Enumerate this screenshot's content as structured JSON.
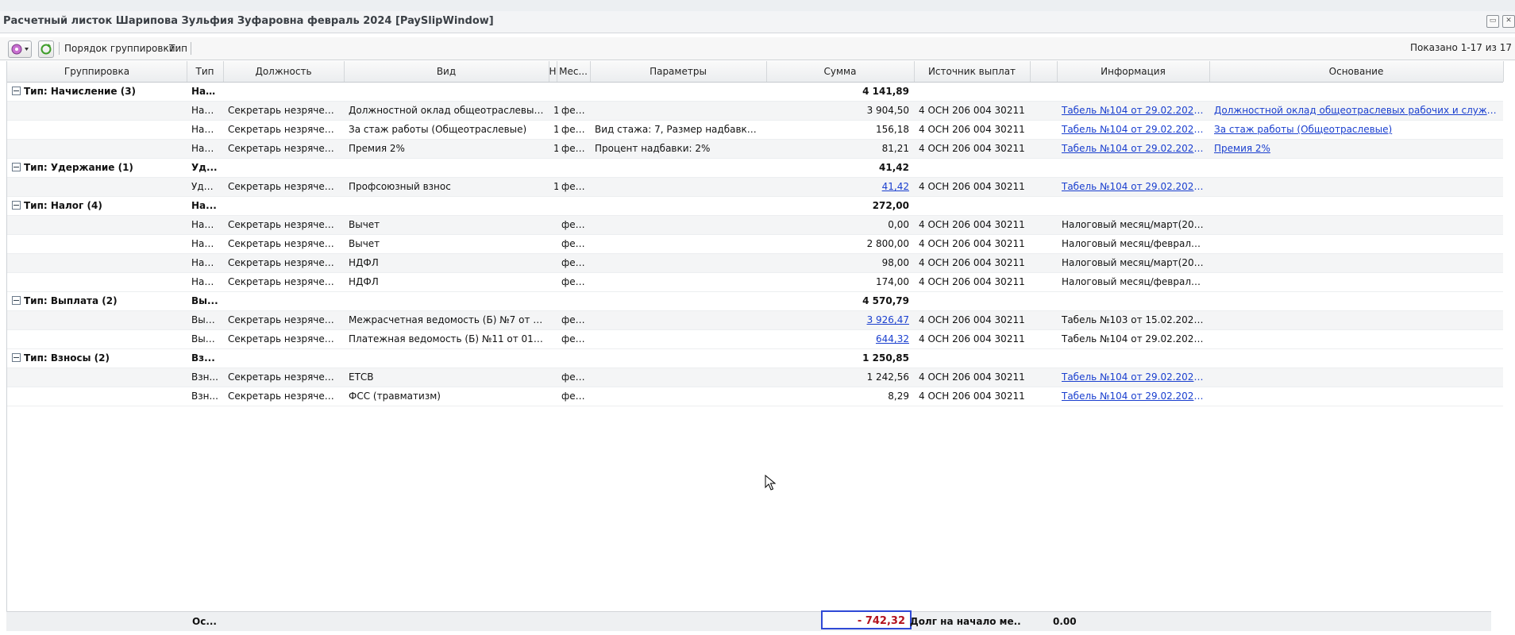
{
  "window": {
    "title": "Расчетный листок Шарипова Зульфия Зуфаровна февраль 2024 [PaySlipWindow]"
  },
  "toolbar": {
    "grouping_label": "Порядок группировки:",
    "grouping_value": "Тип",
    "shown": "Показано 1-17 из 17"
  },
  "columns": [
    "Группировка",
    "Тип",
    "Должность",
    "Вид",
    "Н",
    "Мес...",
    "Параметры",
    "Сумма",
    "Источник выплат",
    "",
    "Информация",
    "Основание"
  ],
  "groups": [
    {
      "label": "Тип: Начисление (3)",
      "type": "Нач...",
      "sum": "4 141,89",
      "rows": [
        {
          "type": "Нач...",
          "pos": "Секретарь незрячего ...",
          "kind": "Должностной оклад общеотраслевых ра...",
          "n": "1",
          "month": "фев...",
          "params": "",
          "sum": "3 904,50",
          "sum_link": false,
          "source": "4 ОСН 206 004 30211",
          "info": "Табель №104 от 29.02.2024 (...",
          "info_link": true,
          "basis": "Должностной оклад общеотраслевых рабочих и служащих",
          "basis_link": true
        },
        {
          "type": "Нач...",
          "pos": "Секретарь незрячего ...",
          "kind": "За стаж работы (Общеотраслевые)",
          "n": "1",
          "month": "фев...",
          "params": "Вид стажа: 7, Размер надбавки (%...",
          "sum": "156,18",
          "sum_link": false,
          "source": "4 ОСН 206 004 30211",
          "info": "Табель №104 от 29.02.2024 (...",
          "info_link": true,
          "basis": "За стаж работы (Общеотраслевые)",
          "basis_link": true
        },
        {
          "type": "Нач...",
          "pos": "Секретарь незрячего ...",
          "kind": "Премия 2%",
          "n": "1",
          "month": "фев...",
          "params": "Процент надбавки: 2%",
          "sum": "81,21",
          "sum_link": false,
          "source": "4 ОСН 206 004 30211",
          "info": "Табель №104 от 29.02.2024 (...",
          "info_link": true,
          "basis": "Премия 2%",
          "basis_link": true
        }
      ]
    },
    {
      "label": "Тип: Удержание (1)",
      "type": "Уд...",
      "sum": "41,42",
      "rows": [
        {
          "type": "Уде...",
          "pos": "Секретарь незрячего ...",
          "kind": "Профсоюзный взнос",
          "n": "1",
          "month": "фев...",
          "params": "",
          "sum": "41,42",
          "sum_link": true,
          "source": "4 ОСН 206 004 30211",
          "info": "Табель №104 от 29.02.2024 (...",
          "info_link": true,
          "basis": "",
          "basis_link": false
        }
      ]
    },
    {
      "label": "Тип: Налог (4)",
      "type": "На...",
      "sum": "272,00",
      "rows": [
        {
          "type": "Налог",
          "pos": "Секретарь незрячего ...",
          "kind": "Вычет",
          "n": "",
          "month": "фев...",
          "params": "",
          "sum": "0,00",
          "sum_link": false,
          "source": "4 ОСН 206 004 30211",
          "info": "Налоговый месяц/март(2024)",
          "info_link": false,
          "basis": "",
          "basis_link": false
        },
        {
          "type": "Налог",
          "pos": "Секретарь незрячего ...",
          "kind": "Вычет",
          "n": "",
          "month": "фев...",
          "params": "",
          "sum": "2 800,00",
          "sum_link": false,
          "source": "4 ОСН 206 004 30211",
          "info": "Налоговый месяц/февраль(2...",
          "info_link": false,
          "basis": "",
          "basis_link": false
        },
        {
          "type": "Налог",
          "pos": "Секретарь незрячего ...",
          "kind": "НДФЛ",
          "n": "",
          "month": "фев...",
          "params": "",
          "sum": "98,00",
          "sum_link": false,
          "source": "4 ОСН 206 004 30211",
          "info": "Налоговый месяц/март(2024)",
          "info_link": false,
          "basis": "",
          "basis_link": false
        },
        {
          "type": "Налог",
          "pos": "Секретарь незрячего ...",
          "kind": "НДФЛ",
          "n": "",
          "month": "фев...",
          "params": "",
          "sum": "174,00",
          "sum_link": false,
          "source": "4 ОСН 206 004 30211",
          "info": "Налоговый месяц/февраль(2...",
          "info_link": false,
          "basis": "",
          "basis_link": false
        }
      ]
    },
    {
      "label": "Тип: Выплата (2)",
      "type": "Вы...",
      "sum": "4 570,79",
      "rows": [
        {
          "type": "Вып...",
          "pos": "Секретарь незрячего ...",
          "kind": "Межрасчетная ведомость (Б) №7 от 15....",
          "n": "",
          "month": "фев...",
          "params": "",
          "sum": "3 926,47",
          "sum_link": true,
          "source": "4 ОСН 206 004 30211",
          "info": "Табель №103 от 15.02.2024 (...",
          "info_link": false,
          "basis": "",
          "basis_link": false
        },
        {
          "type": "Вып...",
          "pos": "Секретарь незрячего ...",
          "kind": "Платежная ведомость (Б) №11 от 01.03....",
          "n": "",
          "month": "фев...",
          "params": "",
          "sum": "644,32",
          "sum_link": true,
          "source": "4 ОСН 206 004 30211",
          "info": "Табель №104 от 29.02.2024 (...",
          "info_link": false,
          "basis": "",
          "basis_link": false
        }
      ]
    },
    {
      "label": "Тип: Взносы (2)",
      "type": "Вз...",
      "sum": "1 250,85",
      "rows": [
        {
          "type": "Взн...",
          "pos": "Секретарь незрячего ...",
          "kind": "ЕТСВ",
          "n": "",
          "month": "фев...",
          "params": "",
          "sum": "1 242,56",
          "sum_link": false,
          "source": "4 ОСН 206 004 30211",
          "info": "Табель №104 от 29.02.2024 (...",
          "info_link": true,
          "basis": "",
          "basis_link": false
        },
        {
          "type": "Взн...",
          "pos": "Секретарь незрячего ...",
          "kind": "ФСС (травматизм)",
          "n": "",
          "month": "фев...",
          "params": "",
          "sum": "8,29",
          "sum_link": false,
          "source": "4 ОСН 206 004 30211",
          "info": "Табель №104 от 29.02.2024 (...",
          "info_link": true,
          "basis": "",
          "basis_link": false
        }
      ]
    }
  ],
  "footer": {
    "type": "Ос...",
    "total": "- 742,32",
    "debt_label": "Долг на начало ме...",
    "debt_value": "0.00"
  },
  "colors": {
    "link": "#1a3fcf",
    "negative": "#b3131f",
    "highlight_border": "#2f49d6"
  }
}
